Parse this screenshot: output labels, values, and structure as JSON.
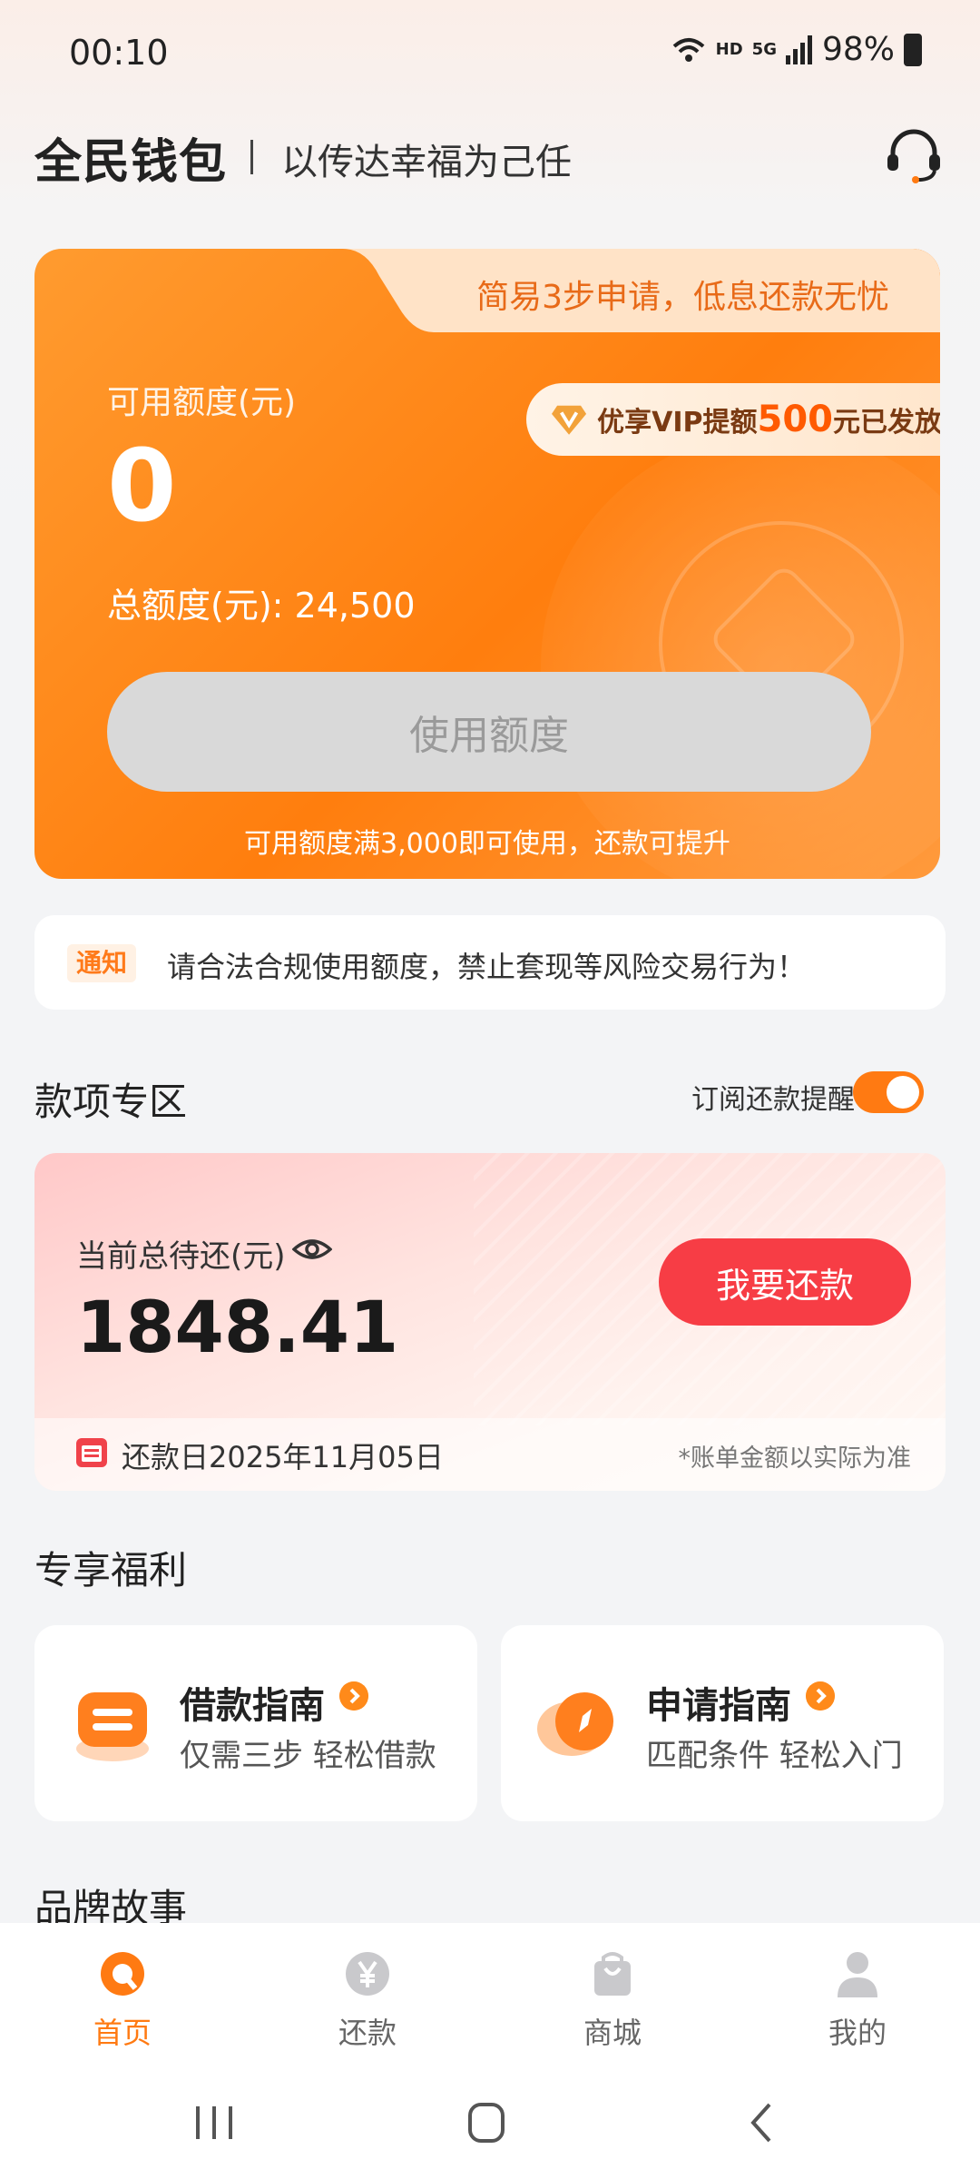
{
  "status": {
    "time": "00:10",
    "hd": "HD",
    "net": "5G",
    "battery": "98%"
  },
  "header": {
    "brand": "全民钱包",
    "slogan": "以传达幸福为己任"
  },
  "card": {
    "promo": "简易3步申请，低息还款无忧",
    "available_label": "可用额度(元)",
    "available_value": "0",
    "total_label": "总额度(元): 24,500",
    "vip_prefix": "优享VIP提额",
    "vip_amount": "500",
    "vip_suffix": "元已发放",
    "use_button": "使用额度",
    "hint": "可用额度满3,000即可使用，还款可提升"
  },
  "notice": {
    "tag": "通知",
    "text": "请合法合规使用额度，禁止套现等风险交易行为！"
  },
  "section_repay": {
    "title": "款项专区",
    "subscribe_label": "订阅还款提醒",
    "subscribe_on": true
  },
  "repay": {
    "label": "当前总待还(元)",
    "amount": "1848.41",
    "button": "我要还款",
    "due_date": "还款日2025年11月05日",
    "note": "*账单金额以实际为准"
  },
  "section_benefits": {
    "title": "专享福利"
  },
  "benefits": [
    {
      "title": "借款指南",
      "subtitle": "仅需三步 轻松借款",
      "icon": "loan-guide-icon"
    },
    {
      "title": "申请指南",
      "subtitle": "匹配条件 轻松入门",
      "icon": "apply-guide-icon"
    }
  ],
  "section_brand": {
    "title": "品牌故事"
  },
  "tabbar": [
    {
      "label": "首页",
      "icon": "home-icon",
      "active": true
    },
    {
      "label": "还款",
      "icon": "yuan-icon",
      "active": false
    },
    {
      "label": "商城",
      "icon": "shopping-bag-icon",
      "active": false
    },
    {
      "label": "我的",
      "icon": "user-icon",
      "active": false
    }
  ],
  "colors": {
    "accent": "#ff7a12",
    "repay_button": "#f73d45",
    "card_orange": "#ff8a1f"
  }
}
